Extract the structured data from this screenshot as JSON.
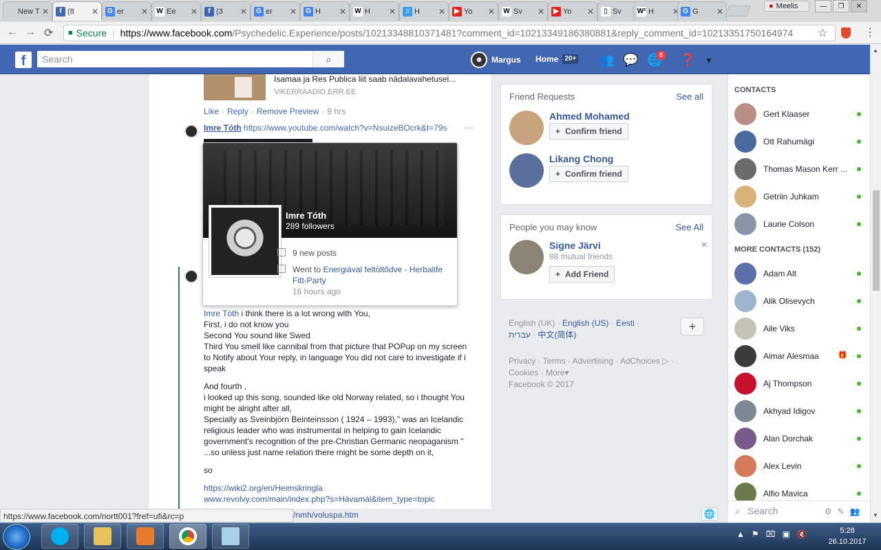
{
  "browser": {
    "tabs": [
      {
        "title": "New T",
        "icon_color": "#cfd3d6",
        "icon": ""
      },
      {
        "title": "(8",
        "icon_color": "#4267b2",
        "icon": "f"
      },
      {
        "title": "er",
        "icon_color": "#4285f4",
        "icon": "G"
      },
      {
        "title": "Ee",
        "icon_color": "#ffffff",
        "icon": "W"
      },
      {
        "title": "(3",
        "icon_color": "#4267b2",
        "icon": "f"
      },
      {
        "title": "er",
        "icon_color": "#4285f4",
        "icon": "G"
      },
      {
        "title": "H",
        "icon_color": "#4285f4",
        "icon": "G"
      },
      {
        "title": "H",
        "icon_color": "#ffffff",
        "icon": "W"
      },
      {
        "title": "H",
        "icon_color": "#3a9de8",
        "icon": "♫"
      },
      {
        "title": "Yo",
        "icon_color": "#e62117",
        "icon": "▶"
      },
      {
        "title": "Sv",
        "icon_color": "#ffffff",
        "icon": "W"
      },
      {
        "title": "Yo",
        "icon_color": "#e62117",
        "icon": "▶"
      },
      {
        "title": "Sv",
        "icon_color": "#ffffff",
        "icon": "▯"
      },
      {
        "title": "H",
        "icon_color": "#ffffff",
        "icon": "W²"
      },
      {
        "title": "G",
        "icon_color": "#4285f4",
        "icon": "G"
      }
    ],
    "profile_name": "Meelis",
    "secure_label": "Secure",
    "url_domain": "https://www.facebook.com",
    "url_path": "/Psychedelic.Experience/posts/10213348810371481?comment_id=10213349186380881&reply_comment_id=10213351750164974"
  },
  "fb_header": {
    "search_placeholder": "Search",
    "user_name": "Margus",
    "home_label": "Home",
    "home_count": "20+",
    "notification_count": "8"
  },
  "feed": {
    "preview_title": "Isamaa ja Res Publica liit saab nädalavahetusel...",
    "preview_domain": "VIKERRAADIO.ERR.EE",
    "actions": [
      "Like",
      "Reply",
      "Remove Preview"
    ],
    "actions_time": "9 hrs",
    "comment_author": "Imre Tóth",
    "comment_link": "https://www.youtube.com/watch?v=NsuizeBOcrk&t=79s",
    "hovercard": {
      "name": "Imre Tóth",
      "followers": "289 followers",
      "new_posts": "9 new posts",
      "went_to_prefix": "Went to ",
      "went_to_place": "Energiával feltöltődve - Herbalife Fitt-Party",
      "went_to_time": "16 hours ago"
    },
    "reply_mention": "Imre Tóth",
    "reply_p1": [
      " i think there is a lot wrong with You,",
      "First, i do not know you",
      "Second You sound like Swed",
      "Third You smell like cannibal from that picture that POPup on my screen to Notify about Your reply, in language You did not care to investigate if i speak"
    ],
    "reply_p2": [
      "And fourth ,",
      "i looked up this song, sounded like old Norway related, so i thought You might be alright after all,",
      "Specially as Sveinbjörn Beinteinsson ( 1924 – 1993),\" was an Icelandic religious leader who was instrumental in helping to gain Icelandic government's recognition of the pre-Christian Germanic neopaganism \"",
      "...so unless just name relation there might be some depth on it,"
    ],
    "reply_p3": "so",
    "links": [
      "https://wiki2.org/en/Heimskringla",
      "www.revolvy.com/main/index.php?s=Hávamál&item_type=topic"
    ],
    "link_partial": "/nmh/voluspa.htm"
  },
  "right_col": {
    "friend_requests_title": "Friend Requests",
    "friend_requests_see_all": "See all",
    "friend_requests": [
      {
        "name": "Ahmed Mohamed",
        "button": "Confirm friend",
        "avatar_color": "#c9a27e"
      },
      {
        "name": "Likang Chong",
        "button": "Confirm friend",
        "avatar_color": "#5b6f9c"
      }
    ],
    "pymk_title": "People you may know",
    "pymk_see_all": "See All",
    "pymk": {
      "name": "Signe Järvi",
      "mutual": "88 mutual friends",
      "button": "Add Friend",
      "avatar_color": "#8d8478"
    },
    "languages": [
      "English (UK)",
      "English (US)",
      "Eesti",
      "עברית",
      "中文(简体)"
    ],
    "footer_links": [
      "Privacy",
      "Terms",
      "Advertising",
      "AdChoices",
      "Cookies",
      "More"
    ],
    "copyright": "Facebook © 2017"
  },
  "chat": {
    "contacts_title": "CONTACTS",
    "contacts": [
      {
        "name": "Gert Klaaser",
        "color": "#b98e84"
      },
      {
        "name": "Ott Rahumägi",
        "color": "#4a6aa0"
      },
      {
        "name": "Thomas Mason Kerr ...",
        "color": "#6b6b6b"
      },
      {
        "name": "Getriin Juhkam",
        "color": "#d9b27a"
      },
      {
        "name": "Laurie Colson",
        "color": "#8a96a8"
      }
    ],
    "more_title": "MORE CONTACTS (152)",
    "more_contacts": [
      {
        "name": "Adam Alt",
        "color": "#5d6fa8"
      },
      {
        "name": "Alik Olisevych",
        "color": "#9fb4cf"
      },
      {
        "name": "Aile Viks",
        "color": "#c7c1b8"
      },
      {
        "name": "Aimar Alesmaa",
        "color": "#3b3b3b"
      },
      {
        "name": "Aj Thompson",
        "color": "#c8102e"
      },
      {
        "name": "Akhyad Idigov",
        "color": "#7d8795"
      },
      {
        "name": "Alan Dorchak",
        "color": "#7a5a8c"
      },
      {
        "name": "Alex Levin",
        "color": "#d57a5a"
      },
      {
        "name": "Alfio Mavica",
        "color": "#6b7a4a"
      }
    ],
    "search_placeholder": "Search"
  },
  "status_url": "https://www.facebook.com/nortt001?fref=ufi&rc=p",
  "taskbar": {
    "time": "5:28",
    "date": "26.10.2017"
  }
}
